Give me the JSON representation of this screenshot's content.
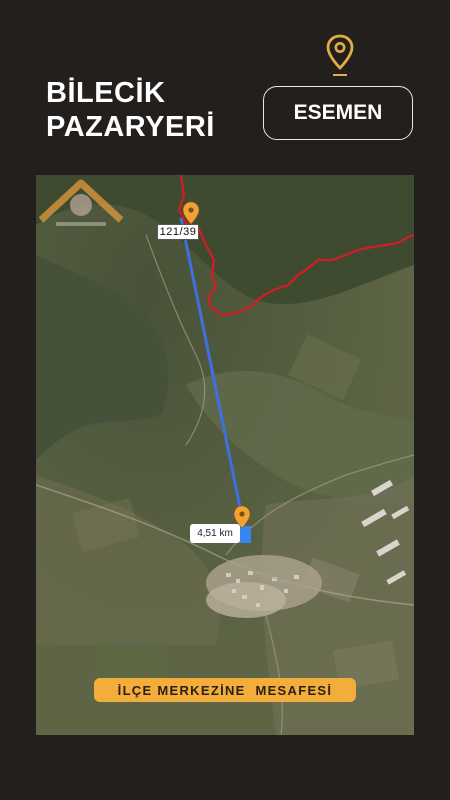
{
  "header": {
    "title_line1": "BİLECİK",
    "title_line2": "PAZARYERİ",
    "location_button": "ESEMEN",
    "pin_icon": "location-pin-icon"
  },
  "map": {
    "parcel_label": "121/39",
    "distance_label": "4,51 km",
    "caption": "İLÇE MERKEZİNE  MESAFESİ",
    "colors": {
      "boundary": "#d41c24",
      "route": "#3f6fe0",
      "marker": "#f2a235",
      "caption_bg": "#f2ad3a"
    },
    "icons": [
      "parcel-marker-icon",
      "destination-marker-icon",
      "watermark-logo"
    ]
  }
}
